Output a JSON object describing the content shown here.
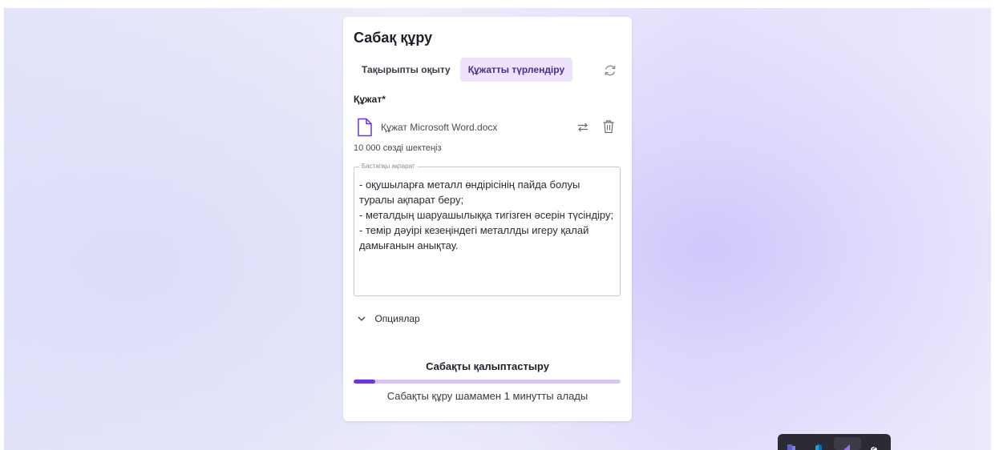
{
  "card": {
    "title": "Сабақ құру",
    "tabs": [
      {
        "label": "Тақырыпты оқыту",
        "active": false
      },
      {
        "label": "Құжатты түрлендіру",
        "active": true
      }
    ],
    "refresh_icon": "refresh-icon",
    "document_label": "Құжат*",
    "file": {
      "icon": "file-icon",
      "name": "Құжат Microsoft Word.docx",
      "swap_icon": "swap-icon",
      "delete_icon": "trash-icon"
    },
    "limit_text": "10 000 сөзді шектеңіз",
    "source_field": {
      "legend": "Бастапқы ақпарат",
      "value": "- оқушыларға металл өндірісінің пайда болуы туралы ақпарат беру;\n- металдың шаруашылыққа тигізген әсерін түсіндіру;\n- темір дәуірі кезеңіндегі металлды игеру қалай дамығанын анықтау."
    },
    "options_label": "Опциялар",
    "generation": {
      "title": "Сабақты қалыптастыру",
      "progress": 0.08,
      "note": "Сабақты құру шамамен 1 минутты алады"
    }
  },
  "colors": {
    "accent": "#6b33e8",
    "accent_light": "#d8c6fb",
    "tab_active_bg": "#ede4fb",
    "taskbar": "#2b2b33"
  },
  "taskbar_icons": [
    "teams-icon",
    "cube-icon",
    "visual-studio-icon",
    "shield-check-icon"
  ]
}
